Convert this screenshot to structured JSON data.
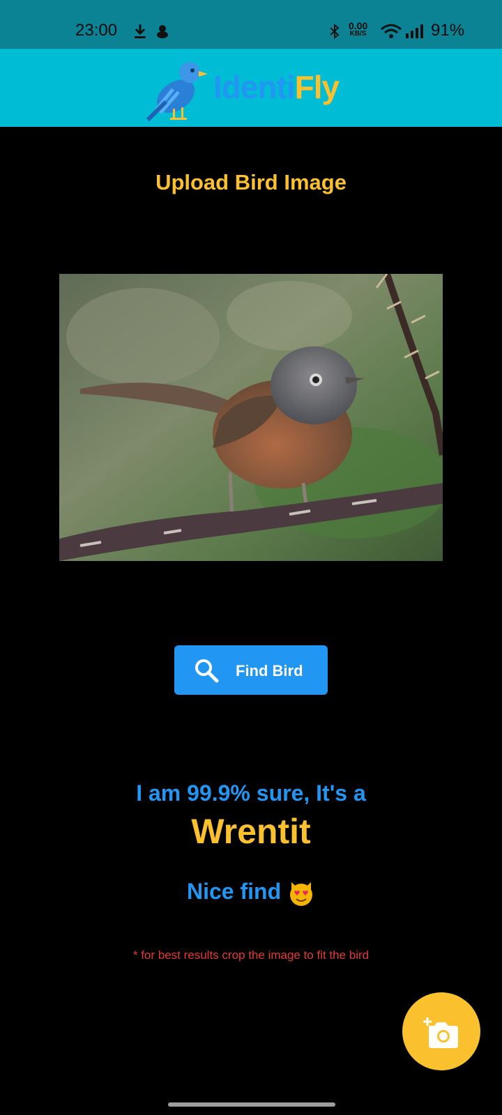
{
  "status_bar": {
    "time": "23:00",
    "speed_value": "0.00",
    "speed_unit": "KB/S",
    "battery": "91%"
  },
  "header": {
    "logo_part1": "Identi",
    "logo_part2": "Fly",
    "colors": {
      "identi": "#2196f3",
      "fly": "#fbc02d",
      "header_bg": "#00bcd4"
    }
  },
  "main": {
    "title": "Upload Bird Image",
    "find_button_label": "Find Bird",
    "result_prefix": "I am 99.9% sure, It's a",
    "species": "Wrentit",
    "nice_find": "Nice find",
    "hint": "* for best results crop the image to fit the bird"
  },
  "icons": {
    "find": "search-icon",
    "fab": "add-photo-camera-icon",
    "emoji": "smiling-cat-heart-eyes-icon"
  }
}
